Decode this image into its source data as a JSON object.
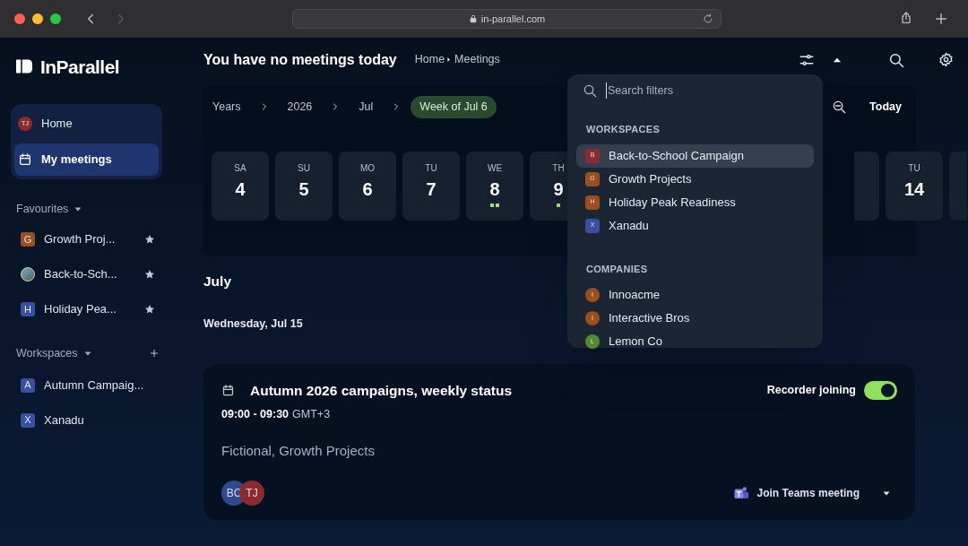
{
  "browser": {
    "url": "in-parallel.com"
  },
  "logo": {
    "text": "InParallel"
  },
  "sidebar": {
    "nav": [
      {
        "kind": "avatar",
        "initials": "TJ",
        "color": "#8b2a2f",
        "label": "Home",
        "selected": false
      },
      {
        "kind": "calendar",
        "label": "My meetings",
        "selected": true
      }
    ],
    "favourites": {
      "title": "Favourites",
      "items": [
        {
          "kind": "letter",
          "letter": "G",
          "color": "#9a4f1c",
          "label": "Growth Proj..."
        },
        {
          "kind": "photo",
          "label": "Back-to-Sch..."
        },
        {
          "kind": "letter",
          "letter": "H",
          "color": "#3b4fa0",
          "label": "Holiday Pea..."
        }
      ]
    },
    "workspaces": {
      "title": "Workspaces",
      "items": [
        {
          "letter": "A",
          "color": "#3b4fa0",
          "label": "Autumn Campaig..."
        },
        {
          "letter": "X",
          "color": "#3b4fa0",
          "label": "Xanadu"
        }
      ]
    }
  },
  "header": {
    "title": "You have no meetings today",
    "breadcrumb": [
      "Home",
      "Meetings"
    ]
  },
  "timeline": {
    "crumbs": [
      {
        "label": "Years",
        "selected": false
      },
      {
        "label": "2026",
        "selected": false
      },
      {
        "label": "Jul",
        "selected": false
      },
      {
        "label": "Week of Jul 6",
        "selected": true
      }
    ],
    "today": "Today"
  },
  "days": [
    {
      "weekday": "SA",
      "day": "4"
    },
    {
      "weekday": "SU",
      "day": "5"
    },
    {
      "weekday": "MO",
      "day": "6"
    },
    {
      "weekday": "TU",
      "day": "7"
    },
    {
      "weekday": "WE",
      "day": "8",
      "markers": [
        {
          "color": "#a6e06e"
        },
        {
          "color": "#a6e06e"
        }
      ]
    },
    {
      "weekday": "TH",
      "day": "9",
      "markers": [
        {
          "color": "#a6e06e"
        }
      ]
    },
    {
      "weekday": "TU",
      "day": "14"
    }
  ],
  "month": "July",
  "date_heading": "Wednesday, Jul 15",
  "meeting": {
    "title": "Autumn 2026 campaigns, weekly status",
    "time": "09:00 - 09:30",
    "timezone": "GMT+3",
    "subtitle": "Fictional, Growth Projects",
    "recorder": {
      "label": "Recorder joining",
      "on": true
    },
    "attendees": [
      {
        "initials": "BC",
        "color": "#2f4a8e"
      },
      {
        "initials": "TJ",
        "color": "#8b2a2f"
      }
    ],
    "join": "Join Teams meeting"
  },
  "filter_dropdown": {
    "search": {
      "placeholder": "Search filters"
    },
    "sections": [
      {
        "title": "WORKSPACES",
        "kind": "square",
        "items": [
          {
            "letter": "B",
            "color": "#8b2a2f",
            "label": "Back-to-School Campaign",
            "selected": true
          },
          {
            "letter": "G",
            "color": "#9a4f1c",
            "label": "Growth Projects",
            "selected": false
          },
          {
            "letter": "H",
            "color": "#9a4f1c",
            "label": "Holiday Peak Readiness",
            "selected": false
          },
          {
            "letter": "X",
            "color": "#3b4fa0",
            "label": "Xanadu",
            "selected": false
          }
        ]
      },
      {
        "title": "COMPANIES",
        "kind": "round",
        "items": [
          {
            "letter": "I",
            "color": "#9a4f1c",
            "label": "Innoacme",
            "selected": false
          },
          {
            "letter": "I",
            "color": "#9a4f1c",
            "label": "Interactive Bros",
            "selected": false
          },
          {
            "letter": "L",
            "color": "#4f8a34",
            "label": "Lemon Co",
            "selected": false
          }
        ]
      }
    ]
  }
}
